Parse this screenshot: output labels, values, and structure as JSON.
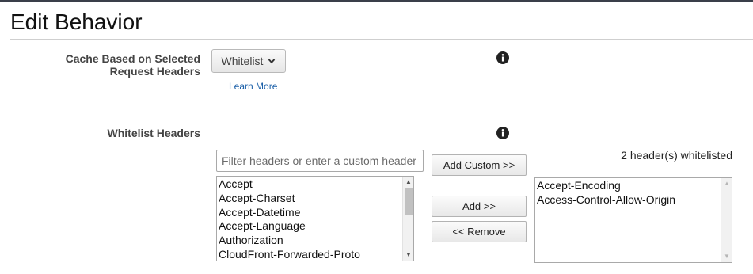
{
  "page": {
    "title": "Edit Behavior"
  },
  "cache_headers": {
    "label_line1": "Cache Based on Selected",
    "label_line2": "Request Headers",
    "dropdown_value": "Whitelist",
    "learn_more": "Learn More"
  },
  "whitelist": {
    "label": "Whitelist Headers",
    "filter_placeholder": "Filter headers or enter a custom header",
    "filter_value": "",
    "available_headers": [
      "Accept",
      "Accept-Charset",
      "Accept-Datetime",
      "Accept-Language",
      "Authorization",
      "CloudFront-Forwarded-Proto"
    ],
    "buttons": {
      "add_custom": "Add Custom >>",
      "add": "Add >>",
      "remove": "<< Remove"
    },
    "count_text": "2 header(s) whitelisted",
    "selected_headers": [
      "Accept-Encoding",
      "Access-Control-Allow-Origin"
    ]
  },
  "icons": {
    "info": "info-icon",
    "dropdown": "chevron-down-icon",
    "scroll_up": "scroll-up-arrow-icon",
    "scroll_down": "scroll-down-arrow-icon"
  },
  "colors": {
    "link": "#1a5fa8",
    "label": "#444444",
    "top_bar": "#3a3f4a"
  }
}
